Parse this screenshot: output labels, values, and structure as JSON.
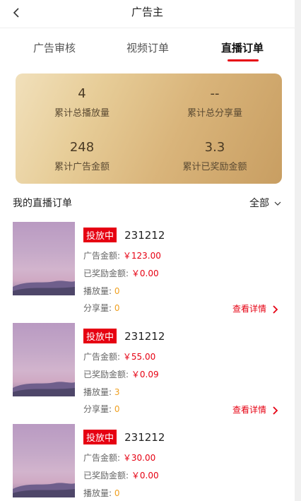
{
  "nav": {
    "title": "广告主"
  },
  "tabs": [
    {
      "label": "广告审核"
    },
    {
      "label": "视频订单"
    },
    {
      "label": "直播订单"
    }
  ],
  "stats": [
    {
      "value": "4",
      "label": "累计总播放量"
    },
    {
      "value": "--",
      "label": "累计总分享量"
    },
    {
      "value": "248",
      "label": "累计广告金额"
    },
    {
      "value": "3.3",
      "label": "累计已奖励金额"
    }
  ],
  "section": {
    "title": "我的直播订单",
    "filter": "全部"
  },
  "orders": [
    {
      "status": "投放中",
      "id": "231212",
      "ad_label": "广告金额:",
      "ad_amount": "￥123.00",
      "reward_label": "已奖励金额:",
      "reward_amount": "￥0.00",
      "play_label": "播放量:",
      "play_count": "0",
      "share_label": "分享量:",
      "share_count": "0",
      "detail": "查看详情"
    },
    {
      "status": "投放中",
      "id": "231212",
      "ad_label": "广告金额:",
      "ad_amount": "￥55.00",
      "reward_label": "已奖励金额:",
      "reward_amount": "￥0.09",
      "play_label": "播放量:",
      "play_count": "3",
      "share_label": "分享量:",
      "share_count": "0",
      "detail": "查看详情"
    },
    {
      "status": "投放中",
      "id": "231212",
      "ad_label": "广告金额:",
      "ad_amount": "￥30.00",
      "reward_label": "已奖励金额:",
      "reward_amount": "￥0.00",
      "play_label": "播放量:",
      "play_count": "0"
    }
  ],
  "colors": {
    "accent": "#e60012",
    "count": "#f0a020",
    "card_gold": "#d9b47a"
  }
}
